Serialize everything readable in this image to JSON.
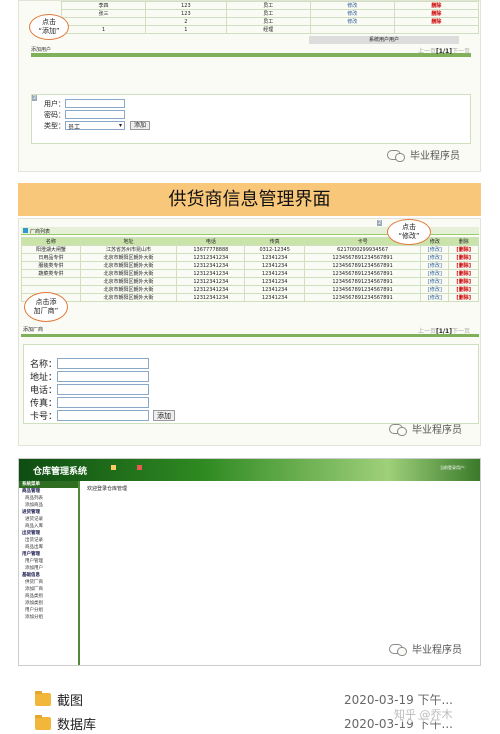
{
  "top": {
    "rows": [
      [
        "李四",
        "123",
        "员工",
        "修改",
        "删除"
      ],
      [
        "张三",
        "123",
        "员工",
        "修改",
        "删除"
      ],
      [
        "",
        "2",
        "员工",
        "修改",
        "删除"
      ],
      [
        "1",
        "1",
        "经理",
        "",
        ""
      ]
    ],
    "sys_user": "系统用户用户",
    "add_user": "添加用户",
    "pager": {
      "prev": "上一页",
      "page": "[1/1]",
      "next": "下一页"
    },
    "callout": [
      "点击",
      "“添加”"
    ],
    "form": {
      "user_label": "用户：",
      "pwd_label": "密码：",
      "type_label": "类型：",
      "type_value": "员工",
      "add_btn": "添加",
      "num": "2"
    }
  },
  "banner": "供货商信息管理界面",
  "supplier": {
    "list_title": "厂商列表",
    "headers": [
      "名称",
      "地址",
      "电话",
      "传真",
      "卡号",
      "修改",
      "删除"
    ],
    "rows": [
      [
        "阳澄湖大闸蟹",
        "江苏省苏州市昆山市",
        "13677778888",
        "0312-12345",
        "6217000299934567"
      ],
      [
        "日用品专供",
        "北京市朝阳区朝外大街",
        "12312341234",
        "12341234",
        "1234567891234567891"
      ],
      [
        "服装类专供",
        "北京市朝阳区朝外大街",
        "12312341234",
        "12341234",
        "1234567891234567891"
      ],
      [
        "蔬菜类专供",
        "北京市朝阳区朝外大街",
        "12312341234",
        "12341234",
        "1234567891234567891"
      ],
      [
        "",
        "北京市朝阳区朝外大街",
        "12312341234",
        "12341234",
        "1234567891234567891"
      ],
      [
        "",
        "北京市朝阳区朝外大街",
        "12312341234",
        "12341234",
        "1234567891234567891"
      ],
      [
        "",
        "北京市朝阳区朝外大街",
        "12312341234",
        "12341234",
        "1234567891234567891"
      ]
    ],
    "edit": "[修改]",
    "del": "[删除]",
    "add_vendor": "添加厂商",
    "pager": {
      "prev": "上一页",
      "page": "[1/1]",
      "next": "下一页"
    },
    "callout_edit": [
      "点击",
      "“修改”"
    ],
    "callout_add": [
      "点击添",
      "加厂商”"
    ],
    "form": {
      "name": "名称：",
      "addr": "地址：",
      "phone": "电话：",
      "fax": "传真：",
      "card": "卡号：",
      "add_btn": "添加"
    },
    "num": "2"
  },
  "warehouse": {
    "title": "仓库管理系统",
    "top_links": "当前登录用户：",
    "welcome": "欢迎登录仓库管理",
    "side": [
      {
        "g": "系统菜单"
      },
      {
        "g": "商品管理"
      },
      {
        "i": "商品列表"
      },
      {
        "i": "添加商品"
      },
      {
        "g": "进货管理"
      },
      {
        "i": "进货记录"
      },
      {
        "i": "商品入库"
      },
      {
        "g": "出货管理"
      },
      {
        "i": "出货记录"
      },
      {
        "i": "商品出库"
      },
      {
        "g": "用户管理"
      },
      {
        "i": "用户管理"
      },
      {
        "i": "添加用户"
      },
      {
        "g": "基础信息"
      },
      {
        "i": "供货厂商"
      },
      {
        "i": "添加厂商"
      },
      {
        "i": "商品类别"
      },
      {
        "i": "添加类别"
      },
      {
        "i": "用户分组"
      },
      {
        "i": "添加分组"
      }
    ]
  },
  "watermark": "毕业程序员",
  "zhihu": "知乎 @乔木",
  "files": [
    {
      "name": "截图",
      "date": "2020-03-19 下午..."
    },
    {
      "name": "数据库",
      "date": "2020-03-19 下午..."
    }
  ]
}
